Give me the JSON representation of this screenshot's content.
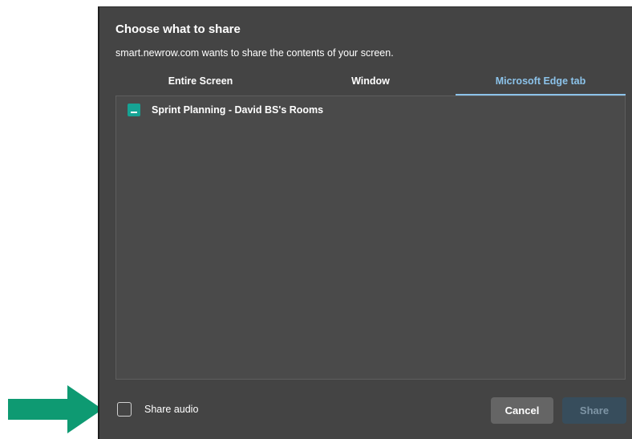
{
  "dialog": {
    "title": "Choose what to share",
    "subtitle": "smart.newrow.com wants to share the contents of your screen.",
    "tabs": [
      {
        "label": "Entire Screen",
        "active": false
      },
      {
        "label": "Window",
        "active": false
      },
      {
        "label": "Microsoft Edge tab",
        "active": true
      }
    ],
    "items": [
      {
        "label": "Sprint Planning - David BS's Rooms",
        "icon": "browser-tab-icon"
      }
    ],
    "share_audio": {
      "label": "Share audio",
      "checked": false
    },
    "buttons": {
      "cancel_label": "Cancel",
      "share_label": "Share",
      "share_enabled": false
    }
  },
  "annotation": {
    "icon": "arrow-right-icon",
    "color": "#0e9a72"
  },
  "colors": {
    "dialog_bg": "#444444",
    "accent": "#8cc3ea",
    "tab_icon": "#16a394"
  }
}
